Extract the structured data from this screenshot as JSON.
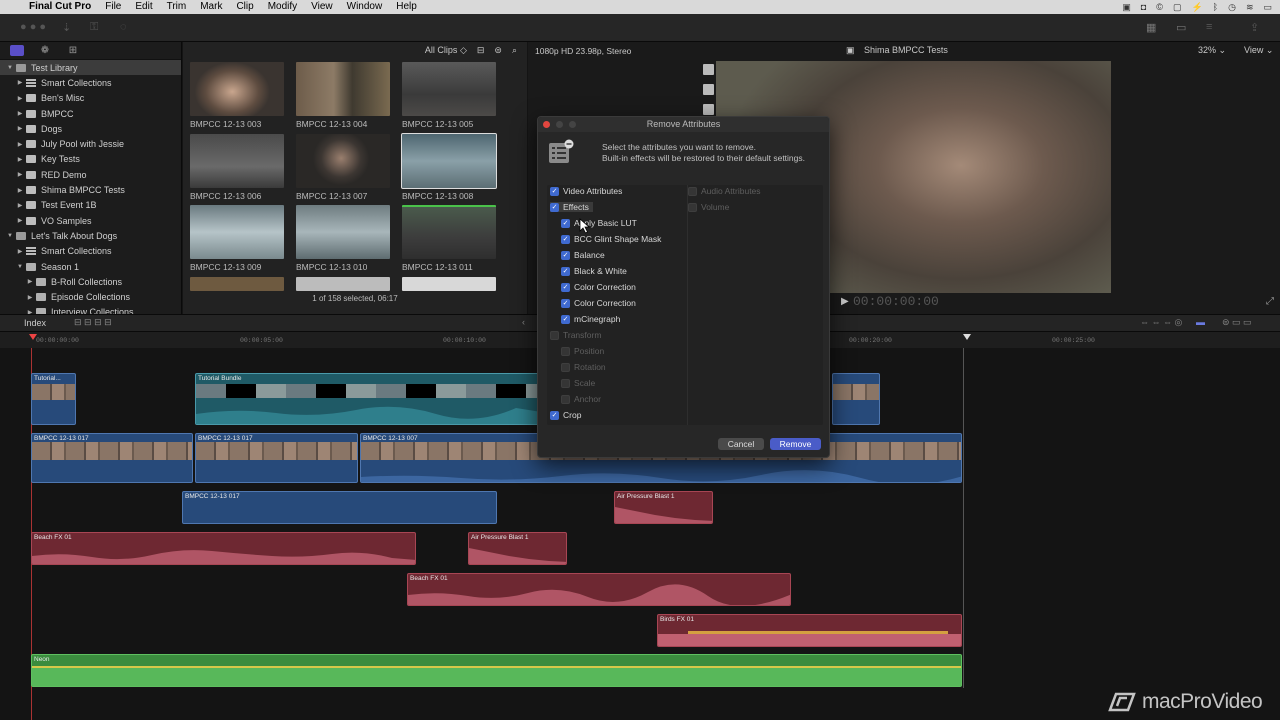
{
  "menubar": {
    "apple_glyph": "",
    "app_name": "Final Cut Pro",
    "items": [
      "File",
      "Edit",
      "Trim",
      "Mark",
      "Clip",
      "Modify",
      "View",
      "Window",
      "Help"
    ]
  },
  "library": {
    "rows": [
      {
        "label": "Test Library",
        "level": 0,
        "kind": "library",
        "selected": true
      },
      {
        "label": "Smart Collections",
        "level": 1,
        "kind": "smart"
      },
      {
        "label": "Ben's Misc",
        "level": 1,
        "kind": "event"
      },
      {
        "label": "BMPCC",
        "level": 1,
        "kind": "event"
      },
      {
        "label": "Dogs",
        "level": 1,
        "kind": "event"
      },
      {
        "label": "July Pool with Jessie",
        "level": 1,
        "kind": "event"
      },
      {
        "label": "Key Tests",
        "level": 1,
        "kind": "event"
      },
      {
        "label": "RED Demo",
        "level": 1,
        "kind": "event"
      },
      {
        "label": "Shima BMPCC Tests",
        "level": 1,
        "kind": "event"
      },
      {
        "label": "Test Event 1B",
        "level": 1,
        "kind": "event"
      },
      {
        "label": "VO Samples",
        "level": 1,
        "kind": "event"
      },
      {
        "label": "Let's Talk About Dogs",
        "level": 0,
        "kind": "library"
      },
      {
        "label": "Smart Collections",
        "level": 1,
        "kind": "smart"
      },
      {
        "label": "Season 1",
        "level": 1,
        "kind": "folder",
        "open": true
      },
      {
        "label": "B-Roll Collections",
        "level": 2,
        "kind": "folder"
      },
      {
        "label": "Episode Collections",
        "level": 2,
        "kind": "folder"
      },
      {
        "label": "Interview Collections",
        "level": 2,
        "kind": "folder"
      }
    ]
  },
  "browser": {
    "filter_label": "All Clips",
    "clips": [
      "BMPCC 12-13  003",
      "BMPCC 12-13  004",
      "BMPCC 12-13  005",
      "BMPCC 12-13  006",
      "BMPCC 12-13  007",
      "BMPCC 12-13  008",
      "BMPCC 12-13  009",
      "BMPCC 12-13  010",
      "BMPCC 12-13  011"
    ],
    "status": "1 of 158 selected, 06:17"
  },
  "viewer": {
    "format": "1080p HD 23.98p, Stereo",
    "title": "Shima BMPCC Tests",
    "zoom": "32%",
    "view_label": "View",
    "timecode": "00:00:00:00"
  },
  "timeline_bar": {
    "index_label": "Index"
  },
  "ruler": {
    "ticks": [
      "00:00:00:00",
      "00:00:05:00",
      "00:00:10:00",
      "00:00:20:00",
      "00:00:25:00"
    ]
  },
  "timeline": {
    "connected": [
      {
        "label": "Tutorial...",
        "kind": "title"
      },
      {
        "label": "Tutorial Bundle",
        "kind": "title"
      }
    ],
    "primary": [
      "BMPCC 12-13  017",
      "BMPCC 12-13  017",
      "BMPCC 12-13  007"
    ],
    "secondary": [
      "BMPCC 12-13  017"
    ],
    "audio": [
      {
        "label": "Air Pressure Blast 1"
      },
      {
        "label": "Beach FX 01"
      },
      {
        "label": "Air Pressure Blast 1"
      },
      {
        "label": "Beach FX 01"
      },
      {
        "label": "Birds FX 01"
      },
      {
        "label": "Neon"
      }
    ]
  },
  "dialog": {
    "title": "Remove Attributes",
    "info_line1": "Select the attributes you want to remove.",
    "info_line2": "Built-in effects will be restored to their default settings.",
    "video_header": "Video Attributes",
    "audio_header": "Audio Attributes",
    "audio_items": [
      "Volume"
    ],
    "effects_label": "Effects",
    "effects": [
      "Apply Basic LUT",
      "BCC Glint Shape Mask",
      "Balance",
      "Black & White",
      "Color Correction",
      "Color Correction",
      "mCinegraph"
    ],
    "transform_label": "Transform",
    "transform_items": [
      "Position",
      "Rotation",
      "Scale",
      "Anchor"
    ],
    "crop_label": "Crop",
    "cancel_label": "Cancel",
    "remove_label": "Remove"
  },
  "watermark": {
    "text": "macProVideo"
  },
  "colors": {
    "accent": "#3f6ad0",
    "video_clip": "#274a7a",
    "audio_clip": "#6e2832",
    "music_clip": "#3b8c3e"
  }
}
